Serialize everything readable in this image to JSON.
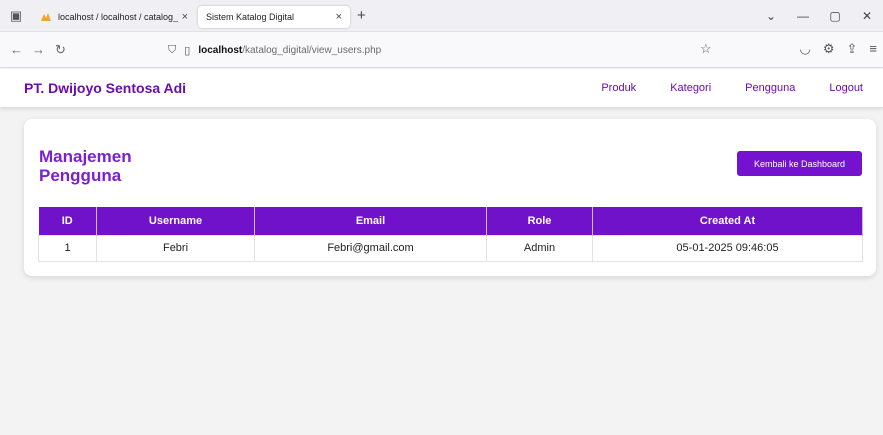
{
  "browser": {
    "tabs": [
      {
        "title": "localhost / localhost / catalog_",
        "close": "×"
      },
      {
        "title": "Sistem Katalog Digital",
        "close": "×"
      }
    ],
    "new_tab": "+",
    "url_host": "localhost",
    "url_path": "/katalog_digital/view_users.php",
    "icons": [
      "tab-list-icon",
      "back-icon",
      "forward-icon",
      "reload-icon",
      "shield-icon",
      "page-icon",
      "bookmark-star-icon",
      "pocket-icon",
      "extensions-icon",
      "share-icon",
      "menu-icon",
      "minimize-icon",
      "maximize-icon",
      "close-window-icon"
    ]
  },
  "header": {
    "brand": "PT. Dwijoyo Sentosa Adi",
    "menu": [
      "Produk",
      "Kategori",
      "Pengguna",
      "Logout"
    ]
  },
  "card": {
    "title": "Manajemen Pengguna",
    "back_button": "Kembali ke Dashboard"
  },
  "table": {
    "columns": [
      "ID",
      "Username",
      "Email",
      "Role",
      "Created At"
    ],
    "rows": [
      [
        "1",
        "Febri",
        "Febri@gmail.com",
        "Admin",
        "05-01-2025 09:46:05"
      ]
    ]
  },
  "colors": {
    "accent": "#6a0dad",
    "table_header": "#6f12c9",
    "button": "#7412cf"
  }
}
